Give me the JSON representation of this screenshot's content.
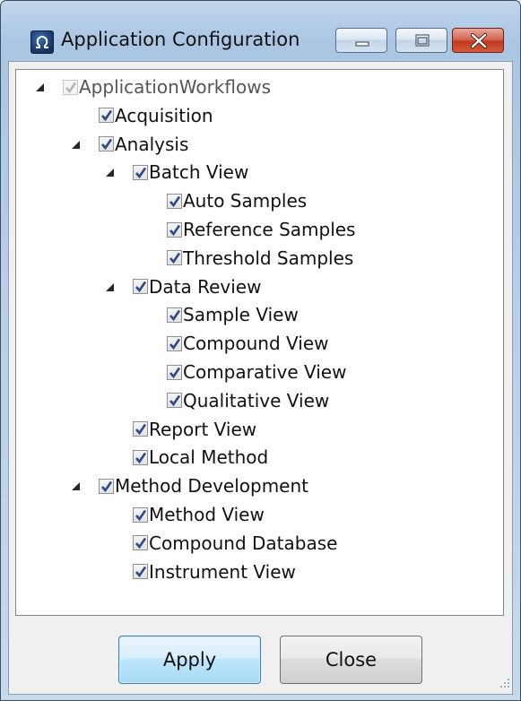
{
  "window": {
    "title": "Application Configuration",
    "app_icon": "omega-logo-icon",
    "caption_buttons": [
      "minimize-icon",
      "maximize-icon",
      "close-icon"
    ]
  },
  "tree": {
    "nodes": [
      {
        "label": "ApplicationWorkflows",
        "level": 0,
        "expandable": true,
        "expanded": true,
        "checked": true,
        "enabled": false
      },
      {
        "label": "Acquisition",
        "level": 1,
        "expandable": false,
        "checked": true,
        "enabled": true
      },
      {
        "label": "Analysis",
        "level": 1,
        "expandable": true,
        "expanded": true,
        "checked": true,
        "enabled": true
      },
      {
        "label": "Batch View",
        "level": 2,
        "expandable": true,
        "expanded": true,
        "checked": true,
        "enabled": true
      },
      {
        "label": "Auto Samples",
        "level": 3,
        "expandable": false,
        "checked": true,
        "enabled": true
      },
      {
        "label": "Reference Samples",
        "level": 3,
        "expandable": false,
        "checked": true,
        "enabled": true
      },
      {
        "label": "Threshold Samples",
        "level": 3,
        "expandable": false,
        "checked": true,
        "enabled": true
      },
      {
        "label": "Data Review",
        "level": 2,
        "expandable": true,
        "expanded": true,
        "checked": true,
        "enabled": true
      },
      {
        "label": "Sample View",
        "level": 3,
        "expandable": false,
        "checked": true,
        "enabled": true
      },
      {
        "label": "Compound View",
        "level": 3,
        "expandable": false,
        "checked": true,
        "enabled": true
      },
      {
        "label": "Comparative View",
        "level": 3,
        "expandable": false,
        "checked": true,
        "enabled": true
      },
      {
        "label": "Qualitative View",
        "level": 3,
        "expandable": false,
        "checked": true,
        "enabled": true
      },
      {
        "label": "Report View",
        "level": 2,
        "expandable": false,
        "checked": true,
        "enabled": true
      },
      {
        "label": "Local Method",
        "level": 2,
        "expandable": false,
        "checked": true,
        "enabled": true
      },
      {
        "label": "Method Development",
        "level": 1,
        "expandable": true,
        "expanded": true,
        "checked": true,
        "enabled": true
      },
      {
        "label": "Method View",
        "level": 2,
        "expandable": false,
        "checked": true,
        "enabled": true
      },
      {
        "label": "Compound Database",
        "level": 2,
        "expandable": false,
        "checked": true,
        "enabled": true
      },
      {
        "label": "Instrument View",
        "level": 2,
        "expandable": false,
        "checked": true,
        "enabled": true
      }
    ]
  },
  "buttons": {
    "apply_label": "Apply",
    "close_label": "Close"
  },
  "colors": {
    "checkmark": "#2b4a87",
    "close_button": "#c9452e",
    "apply_border": "#3c7fb1"
  }
}
